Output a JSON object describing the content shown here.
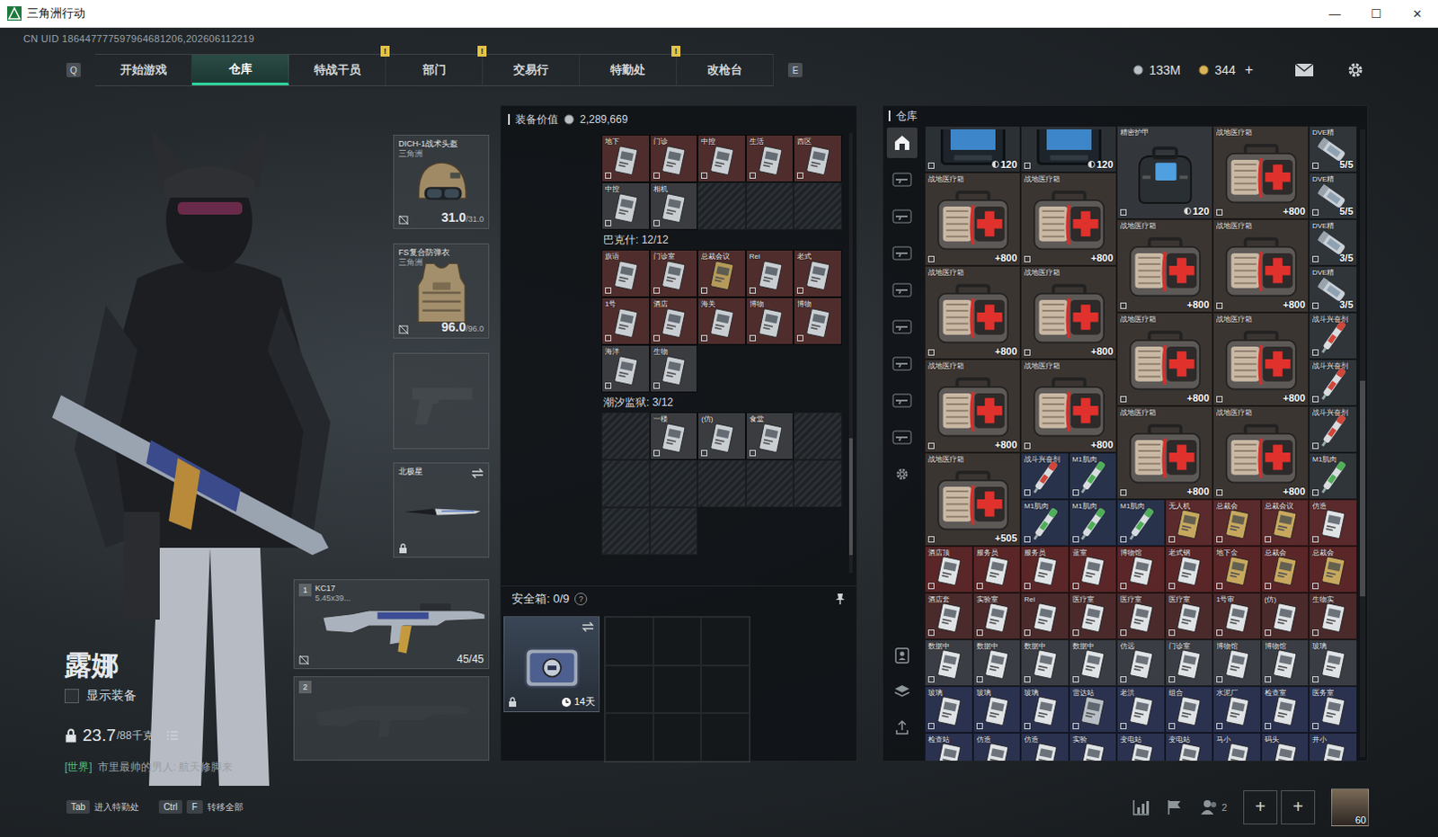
{
  "window": {
    "title": "三角洲行动",
    "controls": [
      "—",
      "☐",
      "✕"
    ]
  },
  "uid": "CN UID 186447777597964681206,202606112219",
  "nav": {
    "left_key": "Q",
    "right_key": "E",
    "badge_text": "!",
    "tabs": [
      {
        "label": "开始游戏",
        "selected": false,
        "badge": false
      },
      {
        "label": "仓库",
        "selected": true,
        "badge": false
      },
      {
        "label": "特战干员",
        "selected": false,
        "badge": true
      },
      {
        "label": "部门",
        "selected": false,
        "badge": true
      },
      {
        "label": "交易行",
        "selected": false,
        "badge": false
      },
      {
        "label": "特勤处",
        "selected": false,
        "badge": true
      },
      {
        "label": "改枪台",
        "selected": false,
        "badge": false
      }
    ]
  },
  "currency": {
    "coins": "133M",
    "bonds": "344",
    "add": "+"
  },
  "character": {
    "name": "露娜",
    "show_equipment": {
      "label": "显示装备",
      "checked": false
    },
    "weight": "23.7",
    "weight_max": "/88千克",
    "chat_channel": "[世界]",
    "chat_text": "市里最帅的男人: 航天修脚来"
  },
  "gear": {
    "helmet": {
      "name": "DICH-1战术头盔",
      "maker": "三角洲",
      "durability": "31.0",
      "max": "/31.0"
    },
    "armor": {
      "name": "FS复合防弹衣",
      "maker": "三角洲",
      "durability": "96.0",
      "max": "/96.0"
    },
    "melee": {
      "name": "北极星"
    },
    "weapons": [
      {
        "index": "1",
        "name": "KC17",
        "caliber": "5.45x39...",
        "ammo": "45/45",
        "empty": false
      },
      {
        "index": "2",
        "empty": true
      }
    ]
  },
  "hints": [
    {
      "keys": [
        "Tab"
      ],
      "label": "进入特勤处"
    },
    {
      "keys": [
        "Ctrl",
        "F"
      ],
      "label": "转移全部"
    }
  ],
  "loadout": {
    "value_label": "装备价值",
    "value": "2,289,669",
    "containers": [
      {
        "slots": [
          {
            "filled": true,
            "label": "地下",
            "color": "#4f2d2c",
            "face": "#c9ced3"
          },
          {
            "filled": true,
            "label": "门诊",
            "color": "#4f2d2c",
            "face": "#c9ced3"
          },
          {
            "filled": true,
            "label": "中控",
            "color": "#4f2d2c",
            "face": "#c9ced3"
          },
          {
            "filled": true,
            "label": "生活",
            "color": "#4f2d2c",
            "face": "#c9ced3"
          },
          {
            "filled": true,
            "label": "西区",
            "color": "#4f2d2c",
            "face": "#c9ced3"
          },
          {
            "filled": true,
            "label": "中控",
            "color": "#3a3c40",
            "face": "#c9ced3"
          },
          {
            "filled": true,
            "label": "相机",
            "color": "#3a3c40",
            "face": "#c9ced3"
          },
          {
            "filled": false
          },
          {
            "filled": false
          },
          {
            "filled": false
          }
        ]
      },
      {
        "title": "巴克什: 12/12",
        "slots": [
          {
            "filled": true,
            "label": "旗语",
            "color": "#4f2d2c",
            "face": "#c9ced3"
          },
          {
            "filled": true,
            "label": "门诊室",
            "color": "#4f2d2c",
            "face": "#c9ced3"
          },
          {
            "filled": true,
            "label": "总裁会议",
            "color": "#4f2d2c",
            "face": "#b59a5a"
          },
          {
            "filled": true,
            "label": "Rei",
            "color": "#4f2d2c",
            "face": "#c9ced3"
          },
          {
            "filled": true,
            "label": "老式",
            "color": "#4f2d2c",
            "face": "#c9ced3"
          },
          {
            "filled": true,
            "label": "1号",
            "color": "#4f2d2c",
            "face": "#c9ced3"
          },
          {
            "filled": true,
            "label": "酒店",
            "color": "#4f2d2c",
            "face": "#c9ced3"
          },
          {
            "filled": true,
            "label": "海关",
            "color": "#4f2d2c",
            "face": "#c9ced3"
          },
          {
            "filled": true,
            "label": "博物",
            "color": "#4f2d2c",
            "face": "#c9ced3"
          },
          {
            "filled": true,
            "label": "博物",
            "color": "#4f2d2c",
            "face": "#c9ced3"
          },
          {
            "filled": true,
            "label": "海洋",
            "color": "#3a3c40",
            "face": "#c9ced3"
          },
          {
            "filled": true,
            "label": "生物",
            "color": "#3a3c40",
            "face": "#c9ced3"
          }
        ]
      },
      {
        "title": "潮汐监狱: 3/12",
        "slots": [
          {
            "filled": false
          },
          {
            "filled": true,
            "label": "一楼",
            "color": "#3a3c40",
            "face": "#c9ced3"
          },
          {
            "filled": true,
            "label": "(仿)",
            "color": "#3a3c40",
            "face": "#c9ced3"
          },
          {
            "filled": true,
            "label": "食堂",
            "color": "#3a3c40",
            "face": "#c9ced3"
          },
          {
            "filled": false
          },
          {
            "filled": false
          },
          {
            "filled": false
          },
          {
            "filled": false
          },
          {
            "filled": false
          },
          {
            "filled": false
          },
          {
            "filled": false
          },
          {
            "filled": false
          }
        ]
      }
    ]
  },
  "safe": {
    "label": "安全箱: 0/9",
    "help": "?",
    "time": "14天"
  },
  "warehouse": {
    "title": "仓库",
    "side_tabs": [
      {
        "kind": "home",
        "selected": true
      },
      {
        "kind": "tag",
        "selected": false
      },
      {
        "kind": "tag",
        "selected": false
      },
      {
        "kind": "tag",
        "selected": false
      },
      {
        "kind": "tag",
        "selected": false
      },
      {
        "kind": "tag",
        "selected": false
      },
      {
        "kind": "tag",
        "selected": false
      },
      {
        "kind": "tag",
        "selected": false
      },
      {
        "kind": "tag",
        "selected": false
      }
    ],
    "items": [
      {
        "kind": "device",
        "count": "120",
        "color": "#2b3035"
      },
      {
        "kind": "device",
        "count": "120",
        "color": "#2b3035"
      },
      {
        "kind": "bag",
        "name": "精密护甲",
        "count": "120",
        "color": "#33373b"
      },
      {
        "kind": "medkit",
        "name": "战地医疗箱",
        "count": "+800",
        "color": "#3b3532"
      },
      {
        "kind": "vial",
        "name": "DVE精",
        "count": "5/5",
        "color": "#30353a",
        "accent": "#9aa3ad"
      },
      {
        "kind": "medkit",
        "name": "战地医疗箱",
        "count": "+800",
        "color": "#3b3532"
      },
      {
        "kind": "medkit",
        "name": "战地医疗箱",
        "count": "+800",
        "color": "#3b3532"
      },
      {
        "kind": "vial",
        "name": "DVE精",
        "count": "5/5",
        "color": "#30353a",
        "accent": "#9aa3ad"
      },
      {
        "kind": "medkit",
        "name": "战地医疗箱",
        "count": "+800",
        "color": "#3b3532"
      },
      {
        "kind": "medkit",
        "name": "战地医疗箱",
        "count": "+800",
        "color": "#3b3532"
      },
      {
        "kind": "vial",
        "name": "DVE精",
        "count": "3/5",
        "color": "#30353a",
        "accent": "#9aa3ad"
      },
      {
        "kind": "medkit",
        "name": "战地医疗箱",
        "count": "+800",
        "color": "#3b3532"
      },
      {
        "kind": "medkit",
        "name": "战地医疗箱",
        "count": "+800",
        "color": "#3b3532"
      },
      {
        "kind": "vial",
        "name": "DVE精",
        "count": "3/5",
        "color": "#30353a",
        "accent": "#9aa3ad"
      },
      {
        "kind": "medkit",
        "name": "战地医疗箱",
        "count": "+800",
        "color": "#3b3532"
      },
      {
        "kind": "medkit",
        "name": "战地医疗箱",
        "count": "+800",
        "color": "#3b3532"
      },
      {
        "kind": "injector",
        "name": "战斗兴奋剂",
        "color": "#30353a",
        "accent": "#d0463a"
      },
      {
        "kind": "medkit",
        "name": "战地医疗箱",
        "count": "+800",
        "color": "#3b3532"
      },
      {
        "kind": "medkit",
        "name": "战地医疗箱",
        "count": "+800",
        "color": "#3b3532"
      },
      {
        "kind": "injector",
        "name": "战斗兴奋剂",
        "color": "#30353a",
        "accent": "#d0463a"
      },
      {
        "kind": "medkit",
        "name": "战地医疗箱",
        "count": "+800",
        "color": "#3b3532"
      },
      {
        "kind": "medkit",
        "name": "战地医疗箱",
        "count": "+800",
        "color": "#3b3532"
      },
      {
        "kind": "injector",
        "name": "战斗兴奋剂",
        "color": "#30353a",
        "accent": "#d0463a"
      },
      {
        "kind": "medkit",
        "name": "战地医疗箱",
        "count": "+505",
        "color": "#3b3532"
      },
      {
        "kind": "injector",
        "name": "战斗兴奋剂",
        "color": "#28324a",
        "accent": "#d0463a"
      },
      {
        "kind": "injector",
        "name": "M1肌肉",
        "color": "#28324a",
        "accent": "#4fae58"
      },
      {
        "kind": "injector",
        "name": "M1肌肉",
        "color": "#30353a",
        "accent": "#4fae58"
      },
      {
        "kind": "injector",
        "name": "M1肌肉",
        "color": "#28324a",
        "accent": "#4fae58"
      },
      {
        "kind": "injector",
        "name": "M1肌肉",
        "color": "#28324a",
        "accent": "#4fae58"
      },
      {
        "kind": "injector",
        "name": "M1肌肉",
        "color": "#28324a",
        "accent": "#4fae58"
      },
      {
        "kind": "keycard",
        "name": "无人机",
        "color": "#5a2a2c",
        "face": "#c8a85e"
      },
      {
        "kind": "keycard",
        "name": "总裁会",
        "color": "#5a2a2c",
        "face": "#c8a85e"
      },
      {
        "kind": "keycard",
        "name": "总裁会议",
        "color": "#5a2a2c",
        "face": "#c8a85e"
      },
      {
        "kind": "keycard",
        "name": "仿造",
        "color": "#5a2a2c",
        "face": "#dfe3e6"
      },
      {
        "kind": "keycard",
        "name": "酒店顶",
        "color": "#5a2628",
        "face": "#dfe3e6"
      },
      {
        "kind": "keycard",
        "name": "服务员",
        "color": "#5a2628",
        "face": "#dfe3e6"
      },
      {
        "kind": "keycard",
        "name": "服务员",
        "color": "#5a2628",
        "face": "#dfe3e6"
      },
      {
        "kind": "keycard",
        "name": "蓝室",
        "color": "#5a2628",
        "face": "#dfe3e6"
      },
      {
        "kind": "keycard",
        "name": "博物馆",
        "color": "#5a2628",
        "face": "#dfe3e6"
      },
      {
        "kind": "keycard",
        "name": "老式钢",
        "color": "#5a2628",
        "face": "#dfe3e6"
      },
      {
        "kind": "keycard",
        "name": "地下金",
        "color": "#5a2628",
        "face": "#c8a85e"
      },
      {
        "kind": "keycard",
        "name": "总裁会",
        "color": "#5a2628",
        "face": "#c8a85e"
      },
      {
        "kind": "keycard",
        "name": "总裁会",
        "color": "#5a2628",
        "face": "#c8a85e"
      },
      {
        "kind": "keycard",
        "name": "酒店套",
        "color": "#4a2a2b",
        "face": "#dfe3e6"
      },
      {
        "kind": "keycard",
        "name": "实验室",
        "color": "#4a2a2b",
        "face": "#dfe3e6"
      },
      {
        "kind": "keycard",
        "name": "Rei",
        "color": "#4a2a2b",
        "face": "#dfe3e6"
      },
      {
        "kind": "keycard",
        "name": "医疗室",
        "color": "#4a2a2b",
        "face": "#dfe3e6"
      },
      {
        "kind": "keycard",
        "name": "医疗室",
        "color": "#4a2a2b",
        "face": "#dfe3e6"
      },
      {
        "kind": "keycard",
        "name": "医疗室",
        "color": "#4a2a2b",
        "face": "#dfe3e6"
      },
      {
        "kind": "keycard",
        "name": "1号审",
        "color": "#4a2a2b",
        "face": "#dfe3e6"
      },
      {
        "kind": "keycard",
        "name": "(仿)",
        "color": "#4a2a2b",
        "face": "#dfe3e6"
      },
      {
        "kind": "keycard",
        "name": "生物实",
        "color": "#4a2a2b",
        "face": "#dfe3e6"
      },
      {
        "kind": "keycard",
        "name": "数据中",
        "color": "#3a3d44",
        "face": "#dfe3e6"
      },
      {
        "kind": "keycard",
        "name": "数据中",
        "color": "#3a3d44",
        "face": "#dfe3e6"
      },
      {
        "kind": "keycard",
        "name": "数据中",
        "color": "#3a3d44",
        "face": "#dfe3e6"
      },
      {
        "kind": "keycard",
        "name": "数据中",
        "color": "#3a3d44",
        "face": "#dfe3e6"
      },
      {
        "kind": "keycard",
        "name": "仿远",
        "color": "#3a3d44",
        "face": "#dfe3e6"
      },
      {
        "kind": "keycard",
        "name": "门诊室",
        "color": "#3a3d44",
        "face": "#dfe3e6"
      },
      {
        "kind": "keycard",
        "name": "博物馆",
        "color": "#3a3d44",
        "face": "#dfe3e6"
      },
      {
        "kind": "keycard",
        "name": "博物馆",
        "color": "#3a3d44",
        "face": "#dfe3e6"
      },
      {
        "kind": "keycard",
        "name": "玻璃",
        "color": "#3a3d44",
        "face": "#dfe3e6"
      },
      {
        "kind": "keycard",
        "name": "玻璃",
        "color": "#2b3250",
        "face": "#dfe3e6"
      },
      {
        "kind": "keycard",
        "name": "玻璃",
        "color": "#2b3250",
        "face": "#dfe3e6"
      },
      {
        "kind": "keycard",
        "name": "玻璃",
        "color": "#2b3250",
        "face": "#dfe3e6"
      },
      {
        "kind": "keycard",
        "name": "雷达站",
        "color": "#2b3250",
        "face": "#b8bec5"
      },
      {
        "kind": "keycard",
        "name": "老洪",
        "color": "#2b3250",
        "face": "#dfe3e6"
      },
      {
        "kind": "keycard",
        "name": "组合",
        "color": "#2b3250",
        "face": "#dfe3e6"
      },
      {
        "kind": "keycard",
        "name": "水泥厂",
        "color": "#2b3250",
        "face": "#dfe3e6"
      },
      {
        "kind": "keycard",
        "name": "检查室",
        "color": "#2b3250",
        "face": "#dfe3e6"
      },
      {
        "kind": "keycard",
        "name": "医务室",
        "color": "#2b3250",
        "face": "#dfe3e6"
      },
      {
        "kind": "keycard",
        "name": "检查站",
        "color": "#2b3250",
        "face": "#dfe3e6"
      },
      {
        "kind": "keycard",
        "name": "仿造",
        "color": "#2b3250",
        "face": "#dfe3e6"
      },
      {
        "kind": "keycard",
        "name": "仿造",
        "color": "#2b3250",
        "face": "#dfe3e6"
      },
      {
        "kind": "keycard",
        "name": "实验",
        "color": "#2b3250",
        "face": "#dfe3e6"
      },
      {
        "kind": "keycard",
        "name": "变电站",
        "color": "#2b3250",
        "face": "#dfe3e6"
      },
      {
        "kind": "keycard",
        "name": "变电站",
        "color": "#2b3250",
        "face": "#dfe3e6"
      },
      {
        "kind": "keycard",
        "name": "马小",
        "color": "#2b3250",
        "face": "#dfe3e6"
      },
      {
        "kind": "keycard",
        "name": "码头",
        "color": "#2b3250",
        "face": "#dfe3e6"
      },
      {
        "kind": "keycard",
        "name": "井小",
        "color": "#2b3250",
        "face": "#dfe3e6"
      }
    ]
  },
  "toolbar": {
    "people": "2",
    "plus": [
      "+",
      "+"
    ],
    "level": "60"
  }
}
